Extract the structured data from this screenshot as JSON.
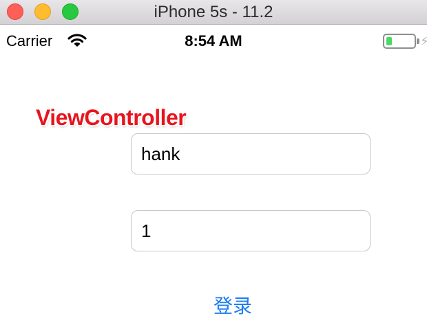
{
  "window": {
    "title": "iPhone 5s - 11.2"
  },
  "status_bar": {
    "carrier": "Carrier",
    "time": "8:54 AM",
    "battery_level_percent": 20,
    "wifi_icon": "wifi-icon",
    "battery_icon": "battery-icon",
    "charging_icon": "charging-bolt-icon"
  },
  "main": {
    "title_label": "ViewController",
    "username_value": "hank",
    "password_value": "1",
    "login_label": "登录"
  },
  "colors": {
    "title_label": "#e8141d",
    "login_tint": "#1a7cf5",
    "battery_fill": "#4cd964"
  }
}
